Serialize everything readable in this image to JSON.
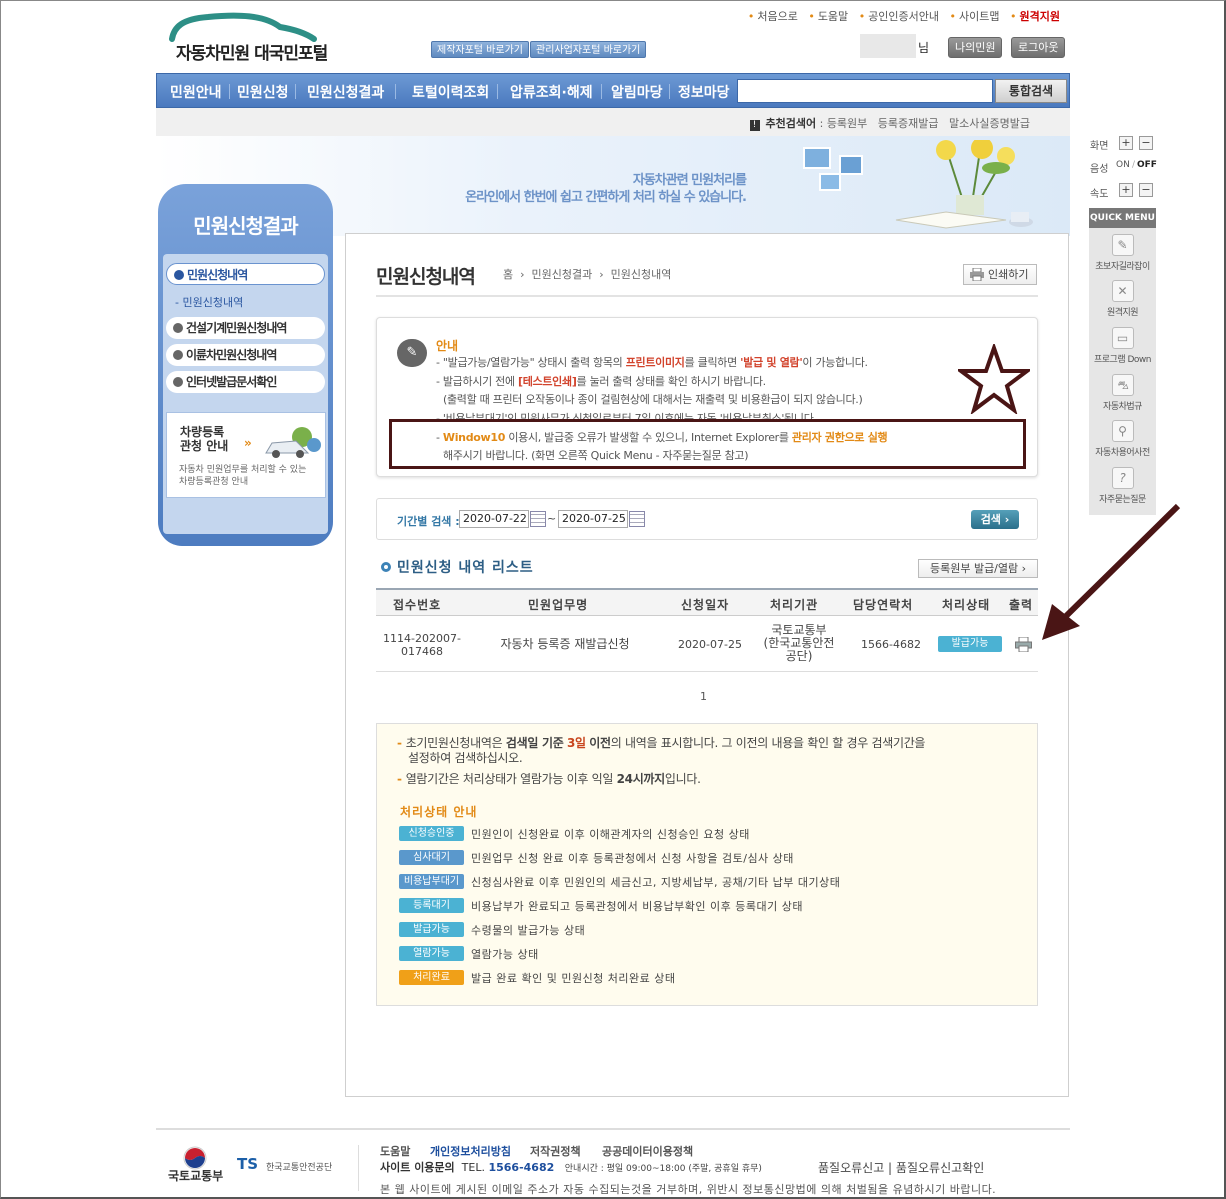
{
  "header": {
    "logo_text": "자동차민원 대국민포털",
    "shortcuts": [
      "제작자포털 바로가기",
      "관리사업자포털 바로가기"
    ],
    "utility_links": [
      "처음으로",
      "도움말",
      "공인인증서안내",
      "사이트맵",
      "원격지원"
    ],
    "user_suffix": "님",
    "my_button": "나의민원",
    "logout_button": "로그아웃"
  },
  "gnb": {
    "items": [
      "민원안내",
      "민원신청",
      "민원신청결과",
      "토털이력조회",
      "압류조회·해제",
      "알림마당",
      "정보마당"
    ],
    "search_placeholder": "",
    "search_button": "통합검색"
  },
  "recommend": {
    "label": "추천검색어",
    "items": [
      "등록원부",
      "등록증재발급",
      "말소사실증명발급"
    ]
  },
  "banner": {
    "line1": "자동차관련 민원처리를",
    "line2": "온라인에서 한번에 쉽고 간편하게 처리 하실 수 있습니다."
  },
  "sidebar": {
    "title": "민원신청결과",
    "items": [
      "민원신청내역",
      "건설기계민원신청내역",
      "이륜차민원신청내역",
      "인터넷발급문서확인"
    ],
    "sub_item": "민원신청내역",
    "banner_title1": "차량등록",
    "banner_title2": "관청 안내",
    "banner_desc1": "자동차 민원업무를 처리할 수 있는",
    "banner_desc2": "차량등록관청 안내"
  },
  "page": {
    "title": "민원신청내역",
    "breadcrumb": [
      "홈",
      "민원신청결과",
      "민원신청내역"
    ],
    "print_button": "인쇄하기"
  },
  "notice": {
    "title": "안내",
    "lines": [
      [
        "- \"발급가능/열람가능\" 상태시 출력 항목의 ",
        "프린트이미지",
        "를 클릭하면 ",
        "'발급 및 열람'",
        "이 가능합니다."
      ],
      [
        "- 발급하시기 전에 ",
        "[테스트인쇄]",
        "를 눌러 출력 상태를 확인 하시기 바랍니다."
      ],
      [
        "(출력할 때 프린터 오작동이나 종이 걸림현상에 대해서는 재출력 및 비용환급이 되지 않습니다.)"
      ],
      [
        "- '비용납부대기'인 민원사무가 신청일로부터 7일 이후에는 자동 '비용납부취소'됩니다."
      ],
      [
        "- ",
        "Window10",
        " 이용시, 발급중 오류가 발생할 수 있으니, Internet Explorer를 ",
        "관리자 권한으로 실행"
      ],
      [
        "해주시기 바랍니다. (화면 오른쪽 Quick Menu - 자주묻는질문 참고)"
      ]
    ]
  },
  "period_search": {
    "label": "기간별 검색 :",
    "start_date": "2020-07-22",
    "separator": "~",
    "end_date": "2020-07-25",
    "button": "검색 ›"
  },
  "list": {
    "title": "민원신청 내역 리스트",
    "register_button": "등록원부 발급/열람 ›",
    "columns": [
      "접수번호",
      "민원업무명",
      "신청일자",
      "처리기관",
      "담당연락처",
      "처리상태",
      "출력"
    ],
    "rows": [
      {
        "receipt_no_1": "1114-202007-",
        "receipt_no_2": "017468",
        "name": "자동차 등록증 재발급신청",
        "date": "2020-07-25",
        "agency_1": "국토교통부",
        "agency_2": "(한국교통안전",
        "agency_3": "공단)",
        "contact": "1566-4682",
        "status": "발급가능",
        "print_icon": "printer-icon"
      }
    ],
    "page": "1"
  },
  "info": {
    "lines": [
      [
        "초기민원신청내역은 ",
        "검색일 기준",
        " ",
        "3일",
        " ",
        "이전",
        "의 내역을 표시합니다. 그 이전의 내용을 확인 할 경우 검색기간을"
      ],
      [
        "설정하여 검색하십시오."
      ],
      [
        "열람기간은 처리상태가 열람가능 이후 익일 ",
        "24시까지",
        "입니다."
      ]
    ],
    "status_title": "처리상태 안내",
    "statuses": [
      {
        "badge": "신청승인중",
        "desc": "민원인이 신청완료 이후 이해관계자의 신청승인 요청 상태",
        "color": "#4bb2d3"
      },
      {
        "badge": "심사대기",
        "desc": "민원업무 신청 완료 이후 등록관청에서 신청 사항을 검토/심사 상태",
        "color": "#5a98cc"
      },
      {
        "badge": "비용납부대기",
        "desc": "신청심사완료 이후 민원인의 세금신고, 지방세납부, 공채/기타 납부 대기상태",
        "color": "#5a98cc"
      },
      {
        "badge": "등록대기",
        "desc": "비용납부가 완료되고 등록관청에서 비용납부확인 이후 등록대기 상태",
        "color": "#4bb2d3"
      },
      {
        "badge": "발급가능",
        "desc": "수령물의 발급가능 상태",
        "color": "#4bb2d3"
      },
      {
        "badge": "열람가능",
        "desc": "열람가능 상태",
        "color": "#4bb2d3"
      },
      {
        "badge": "처리완료",
        "desc": "발급 완료 확인 및 민원신청 처리완료 상태",
        "color": "#f0a018"
      }
    ]
  },
  "quick_menu": {
    "screen_label": "화면",
    "voice_label": "음성",
    "voice_on": "ON",
    "voice_off": "OFF",
    "speed_label": "속도",
    "header": "QUICK MENU",
    "items": [
      "초보자길라잡이",
      "원격지원",
      "프로그램 Down",
      "자동차법규",
      "자동차용어사전",
      "자주묻는질문"
    ]
  },
  "footer": {
    "molit": "국토교통부",
    "ts_logo": "TS",
    "ts_name": "한국교통안전공단",
    "links": [
      "도움말",
      "개인정보처리방침",
      "저작권정책",
      "공공데이터이용정책"
    ],
    "contact_label": "사이트 이용문의",
    "tel_label": "TEL.",
    "tel": "1566-4682",
    "hours": "안내시간 : 평일 09:00~18:00 (주말, 공휴일 휴무)",
    "error_links": "품질오류신고 | 품질오류신고확인",
    "notice": "본 웹 사이트에 게시된 이메일 주소가 자동 수집되는것을 거부하며, 위반시 정보통신망법에 의해 처벌됨을 유념하시기 바랍니다."
  },
  "colors": {
    "brand": "#4a79be",
    "accent": "#e28a16",
    "annotation": "#4a1515"
  }
}
